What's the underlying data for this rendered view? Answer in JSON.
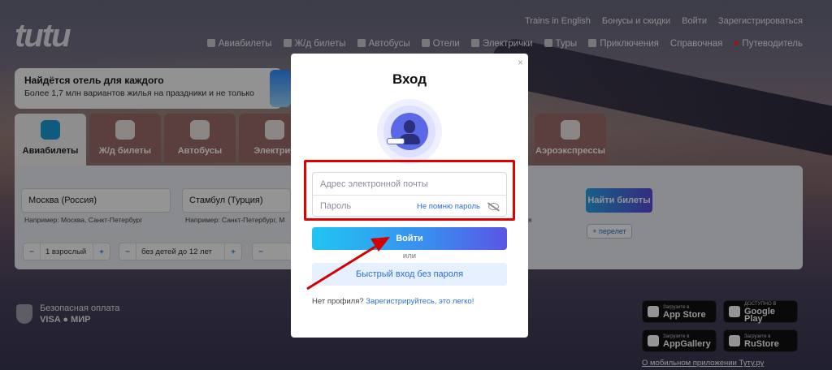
{
  "header": {
    "logo": "tutu",
    "top_links": [
      "Trains in English",
      "Бонусы и скидки",
      "Войти",
      "Зарегистрироваться"
    ],
    "nav": [
      "Авиабилеты",
      "Ж/д билеты",
      "Автобусы",
      "Отели",
      "Электрички",
      "Туры",
      "Приключения",
      "Справочная",
      "Путеводитель"
    ]
  },
  "promo": {
    "title": "Найдётся отель для каждого",
    "subtitle": "Более 1,7 млн вариантов жилья на праздники и не только"
  },
  "tabs": [
    {
      "label": "Авиабилеты",
      "icon": "plane-icon",
      "active": true
    },
    {
      "label": "Ж/д билеты",
      "icon": "train-icon",
      "active": false
    },
    {
      "label": "Автобусы",
      "icon": "bus-icon",
      "active": false
    },
    {
      "label": "Электрич",
      "icon": "suburban-train-icon",
      "active": false
    },
    {
      "label": "Аэроэкспрессы",
      "icon": "aeroexpress-icon",
      "active": false
    }
  ],
  "search": {
    "from": "Москва (Россия)",
    "to": "Стамбул (Турция)",
    "from_hint": "Например: Москва, Санкт-Петербург",
    "to_hint": "Например: Санкт-Петербург, М",
    "extra_hint": "я",
    "find_button": "Найти билеты",
    "add_flight": "+ перелет",
    "passengers": "1 взрослый",
    "children": "без детей до 12 лет",
    "minus": "−",
    "plus": "+"
  },
  "footer": {
    "secure_title": "Безопасная оплата",
    "secure_cards": "VISA ● МИР",
    "stores": [
      {
        "small": "Загрузите в",
        "big": "App Store",
        "icon": "apple-icon"
      },
      {
        "small": "ДОСТУПНО В",
        "big": "Google Play",
        "icon": "google-play-icon"
      },
      {
        "small": "Загрузите в",
        "big": "AppGallery",
        "icon": "appgallery-icon"
      },
      {
        "small": "Загрузите в",
        "big": "RuStore",
        "icon": "rustore-icon"
      }
    ],
    "mobile_link": "О мобильном приложении Туту.ру"
  },
  "modal": {
    "title": "Вход",
    "close": "×",
    "email_placeholder": "Адрес электронной почты",
    "password_placeholder": "Пароль",
    "forgot": "Не помню пароль",
    "login_button": "Войти",
    "or": "или",
    "quick_login": "Быстрый вход без пароля",
    "no_profile": "Нет профиля?",
    "register": "Зарегистрируйтесь, это легко!"
  },
  "colors": {
    "highlight": "#e00000",
    "accent": "#2b6fd6",
    "arrow": "#d40000"
  }
}
